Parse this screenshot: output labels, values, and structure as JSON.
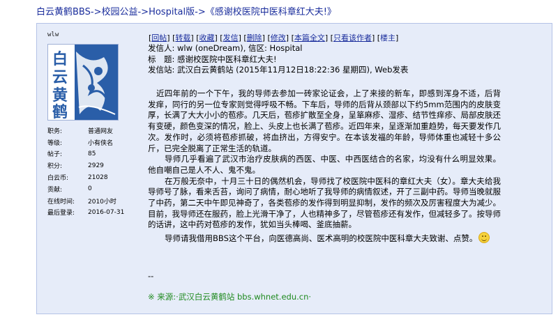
{
  "breadcrumb": {
    "site": "白云黄鹤BBS",
    "sep": "->",
    "section": "校园公益",
    "board": "Hospital版",
    "title": "《感谢校医院中医科章红大夫!》"
  },
  "user": {
    "name": "wlw",
    "avatar_text": "白云黄鹤",
    "stats": [
      {
        "label": "职务:",
        "value": "普通网友"
      },
      {
        "label": "等级:",
        "value": "小有侠名"
      },
      {
        "label": "帖子:",
        "value": "85"
      },
      {
        "label": "积分:",
        "value": "2929"
      },
      {
        "label": "白云币:",
        "value": "21028"
      },
      {
        "label": "贡献:",
        "value": "0"
      },
      {
        "label": "在线时间:",
        "value": "2010小时"
      },
      {
        "label": "最后登录:",
        "value": "2016-07-31"
      }
    ]
  },
  "toolbar": {
    "reply": "回帖",
    "forward": "转载",
    "favorite": "收藏",
    "send_mail": "发信",
    "delete": "删除",
    "edit": "修改",
    "full_text": "本篇全文",
    "author_only": "只看该作者",
    "floor": "楼主"
  },
  "header": {
    "from_label": "发信人:",
    "from_value": "wlw (oneDream), 信区: Hospital",
    "subject_label": "标　题:",
    "subject_value": "感谢校医院中医科章红大夫!",
    "station_label": "发信站:",
    "station_value": "武汉白云黄鹤站 (2015年11月12日18:22:36 星期四), Web发表"
  },
  "content": {
    "p1": "近四年前的一个下午，我的导师去参加一砖家论证会，上了来接的新车，即感到浑身不适，后背发痒，同行的另一位专家则觉得呼吸不畅。下车后，导师的后背从颈部以下约5mm范围内的皮肤变厚，长满了大大小小的苞疹。几天后，苞疹扩散至全身，呈箪麻疹、湿疹、结节性痒疹、局部皮肤还有变硬，颜色变深的情况，脸上、头皮上也长满了苞疹。近四年来，呈逐渐加重趋势，每天要发作几次。发作时，必须将苞疹抓破，将血挤出，方得安宁。在本该发福的年龄，导师体重也减轻十多公斤，已完全脱离了正常生活的轨道。",
    "p2": "导师几乎看遍了武汉市治疗皮肤病的西医、中医、中西医结合的名家，均没有什么明显效果。他自嘲自己是人不人、鬼不鬼。",
    "p3": "在万般无奈中，十月三十日的偶然机会，导师找了校医院中医科的章红大夫（女）。章大夫给我导师号了脉，看来舌苔，询问了病情，耐心地听了我导师的病情叙述，开了三副中药。导师当晚就服了中药，第二天中午即见神奇了，各类苞疹的发作得到明显抑制，发作的频次及厉害程度大为减少。目前，我导师还在服药，脸上光滑干净了，人也精神多了，尽管苞疹还有发作，但减轻多了。按导师的话讲，这中药对苞疹的发作，犹如当头棒喝、釜底抽薪。",
    "p4": "导师请我借用BBS这个平台，向医德高尚、医术高明的校医院中医科章大夫致谢、点赞。",
    "dash": "--",
    "source": "※ 来源:·武汉白云黄鹤站 bbs.whnet.edu.cn·"
  },
  "colors": {
    "link": "#1a2d9c",
    "panel_bg": "#e6ecf9",
    "source_green": "#1f8a1f",
    "avatar_blue": "#2a5ea8"
  }
}
